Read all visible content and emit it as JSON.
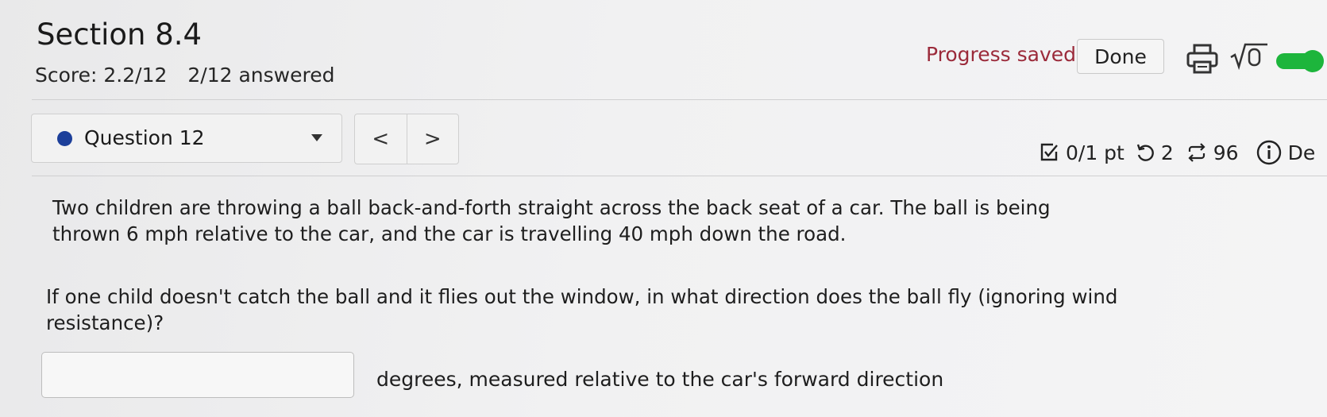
{
  "header": {
    "title": "Section 8.4",
    "score": "Score: 2.2/12",
    "answered": "2/12 answered",
    "progress_status": "Progress saved",
    "done_label": "Done",
    "accent_color": "#9b2a3a",
    "toggle_color": "#1db53c"
  },
  "question_nav": {
    "selected_question": "Question 12",
    "prev_symbol": "<",
    "next_symbol": ">"
  },
  "meta": {
    "points": "0/1 pt",
    "retries": "2",
    "attempts": "96",
    "details_label": "De"
  },
  "question": {
    "paragraph1": "Two children are throwing a ball back-and-forth straight across the back seat of a car. The ball is being thrown 6 mph relative to the car, and the car is travelling 40 mph down the road.",
    "paragraph2": "If one child doesn't catch the ball and it flies out the window, in what direction does the ball fly (ignoring wind resistance)?",
    "answer_value": "",
    "unit_text": "degrees, measured relative to the car's forward direction"
  }
}
